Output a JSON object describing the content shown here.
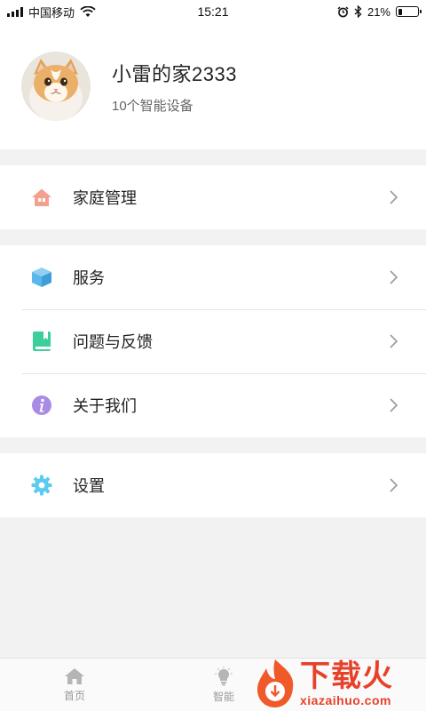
{
  "status_bar": {
    "carrier": "中国移动",
    "time": "15:21",
    "battery_percent": "21%",
    "battery_level": 0.21,
    "icons": [
      "signal-icon",
      "wifi-icon",
      "alarm-icon",
      "bluetooth-icon",
      "battery-icon"
    ]
  },
  "profile": {
    "home_name": "小雷的家2333",
    "device_count": "10个智能设备",
    "avatar": "cat-avatar"
  },
  "menu_groups": [
    [
      {
        "label": "家庭管理",
        "icon": "house-icon",
        "color": "#f4a08e"
      }
    ],
    [
      {
        "label": "服务",
        "icon": "box-icon",
        "color": "#5cb6ea"
      },
      {
        "label": "问题与反馈",
        "icon": "book-icon",
        "color": "#3ccf9b"
      },
      {
        "label": "关于我们",
        "icon": "info-icon",
        "color": "#a98be6"
      }
    ],
    [
      {
        "label": "设置",
        "icon": "gear-icon",
        "color": "#5ccbf0"
      }
    ]
  ],
  "tabbar": {
    "tabs": [
      {
        "label": "首页",
        "icon": "home-tab-icon"
      },
      {
        "label": "智能",
        "icon": "bulb-tab-icon"
      }
    ]
  },
  "watermark": {
    "big": "下载火",
    "small": "xiazaihuo.com"
  }
}
